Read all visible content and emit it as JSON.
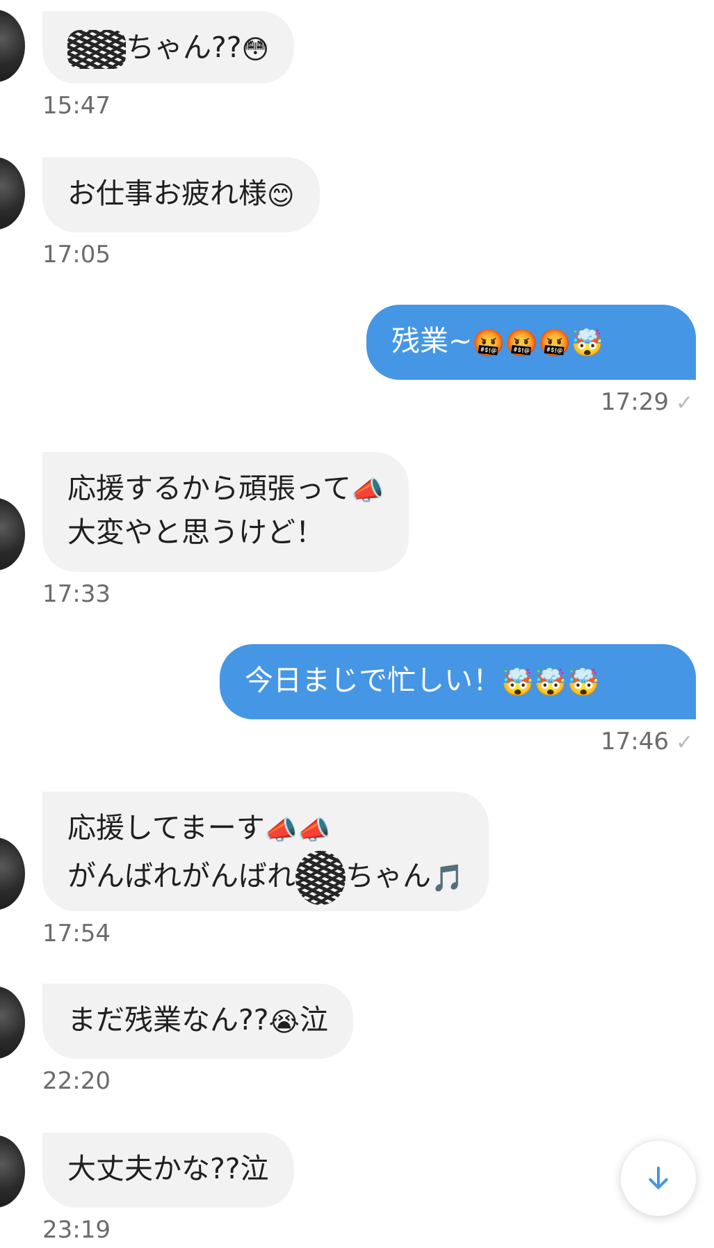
{
  "messages": [
    {
      "dir": "in",
      "text": "ちゃん??",
      "emoji": "😳",
      "time": "15:47"
    },
    {
      "dir": "in",
      "text": "お仕事お疲れ様",
      "emoji": "😊",
      "time": "17:05"
    },
    {
      "dir": "out",
      "text": "残業~",
      "emoji": "🤬🤬🤬🤯",
      "time": "17:29"
    },
    {
      "dir": "in",
      "line1": "応援するから頑張って",
      "line1_emoji": "📣",
      "line2": "大変やと思うけど！",
      "time": "17:33"
    },
    {
      "dir": "out",
      "text": "今日まじで忙しい！",
      "emoji": "🤯🤯🤯",
      "time": "17:46"
    },
    {
      "dir": "in",
      "line1": "応援してまーす",
      "line1_emoji": "📣📣",
      "line2": "がんばれがんばれ",
      "line2_suffix": "ちゃん",
      "line2_emoji": "🎵",
      "time": "17:54"
    },
    {
      "dir": "in",
      "text": "まだ残業なん??",
      "emoji": "😭",
      "suffix": "泣",
      "time": "22:20"
    },
    {
      "dir": "in",
      "text": "大丈夫かな??泣",
      "time": "23:19"
    }
  ],
  "read_check": "✓",
  "scroll_button": {
    "icon": "arrow-down-icon"
  },
  "colors": {
    "incoming_bubble": "#f2f2f3",
    "outgoing_bubble": "#4596e5",
    "timestamp": "#6b6b6b"
  }
}
